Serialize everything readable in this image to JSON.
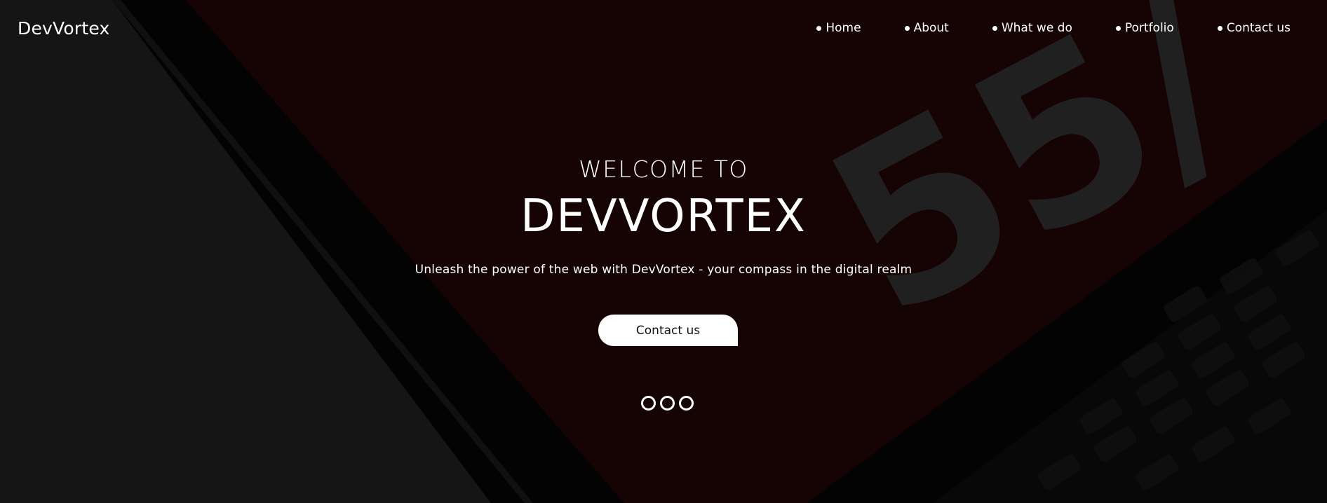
{
  "brand": {
    "name": "DevVortex"
  },
  "nav": {
    "items": [
      {
        "label": "Home"
      },
      {
        "label": "About"
      },
      {
        "label": "What we do"
      },
      {
        "label": "Portfolio"
      },
      {
        "label": "Contact us"
      }
    ]
  },
  "hero": {
    "welcome": "WELCOME TO",
    "title": "DEVVORTEX",
    "tagline": "Unleash the power of the web with DevVortex - your compass in the digital realm",
    "cta_label": "Contact us",
    "background_decal_text": "55/"
  },
  "colors": {
    "background": "#1a1a1a",
    "screen_red": "#1e0606",
    "text": "#ffffff",
    "button_bg": "#ffffff",
    "button_text": "#111111"
  },
  "carousel": {
    "slide_count": 3
  }
}
